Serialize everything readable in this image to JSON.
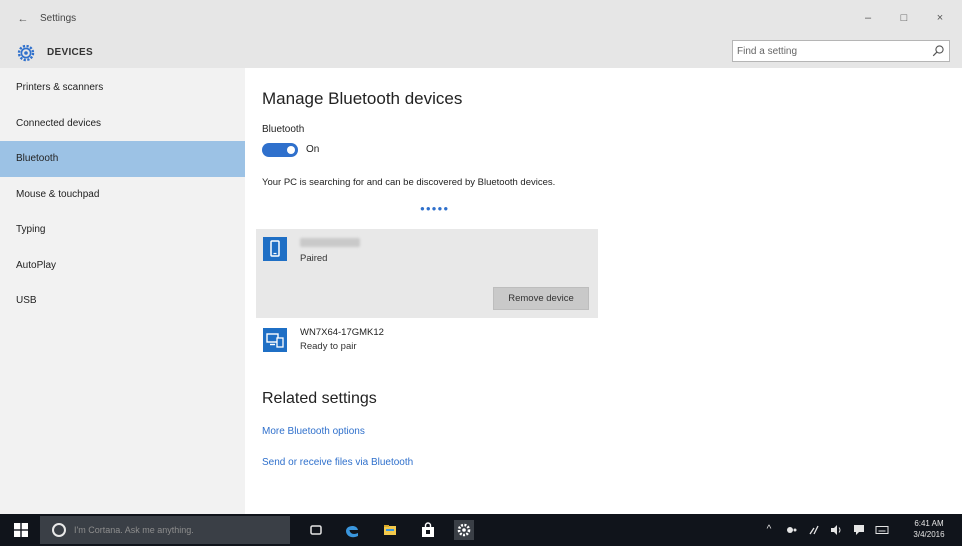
{
  "window": {
    "title": "Settings",
    "back_glyph": "←",
    "minimize_glyph": "–",
    "maximize_glyph": "□",
    "close_glyph": "×"
  },
  "header": {
    "section_title": "DEVICES",
    "search": {
      "placeholder": "Find a setting",
      "value": ""
    }
  },
  "sidebar": {
    "items": [
      {
        "label": "Printers & scanners",
        "selected": false
      },
      {
        "label": "Connected devices",
        "selected": false
      },
      {
        "label": "Bluetooth",
        "selected": true
      },
      {
        "label": "Mouse & touchpad",
        "selected": false
      },
      {
        "label": "Typing",
        "selected": false
      },
      {
        "label": "AutoPlay",
        "selected": false
      },
      {
        "label": "USB",
        "selected": false
      }
    ]
  },
  "main": {
    "title": "Manage Bluetooth devices",
    "bluetooth_label": "Bluetooth",
    "toggle_state": "On",
    "discover_text": "Your PC is searching for and can be discovered by Bluetooth devices.",
    "devices": [
      {
        "name": "",
        "status": "Paired",
        "icon": "phone-icon",
        "selected": true,
        "action": "Remove device"
      },
      {
        "name": "WN7X64-17GMK12",
        "status": "Ready to pair",
        "icon": "computer-icon",
        "selected": false
      }
    ],
    "related_title": "Related settings",
    "related_links": [
      "More Bluetooth options",
      "Send or receive files via Bluetooth"
    ]
  },
  "taskbar": {
    "search_placeholder": "I'm Cortana. Ask me anything.",
    "clock_time": "6:41 AM",
    "clock_date": "3/4/2016",
    "tray_up_glyph": "^"
  },
  "colors": {
    "accent": "#2f70cc",
    "selected_nav": "#9cc2e5",
    "taskbar": "#10141b",
    "chrome": "#e6e6e6"
  }
}
